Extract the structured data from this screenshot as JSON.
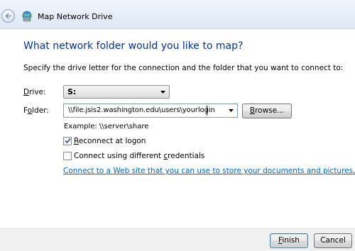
{
  "window": {
    "title": "Map Network Drive"
  },
  "heading": "What network folder would you like to map?",
  "instructions": "Specify the drive letter for the connection and the folder that you want to connect to:",
  "drive": {
    "label_accel": "D",
    "label_rest": "rive:",
    "value": "S:"
  },
  "folder": {
    "label_pre": "F",
    "label_accel": "o",
    "label_rest": "lder:",
    "value": "\\\\file.jsis2.washington.edu\\users\\yourlogin",
    "browse_accel": "B",
    "browse_rest": "rowse..."
  },
  "example": "Example: \\\\server\\share",
  "reconnect": {
    "accel": "R",
    "rest": "econnect at logon",
    "checked": true
  },
  "credentials": {
    "pre": "Connect using different ",
    "accel": "c",
    "rest": "redentials",
    "checked": false
  },
  "link": {
    "text": "Connect to a Web site that you can use to store your documents and pictures",
    "suffix": "."
  },
  "buttons": {
    "finish_accel": "F",
    "finish_rest": "inish",
    "cancel": "Cancel"
  }
}
